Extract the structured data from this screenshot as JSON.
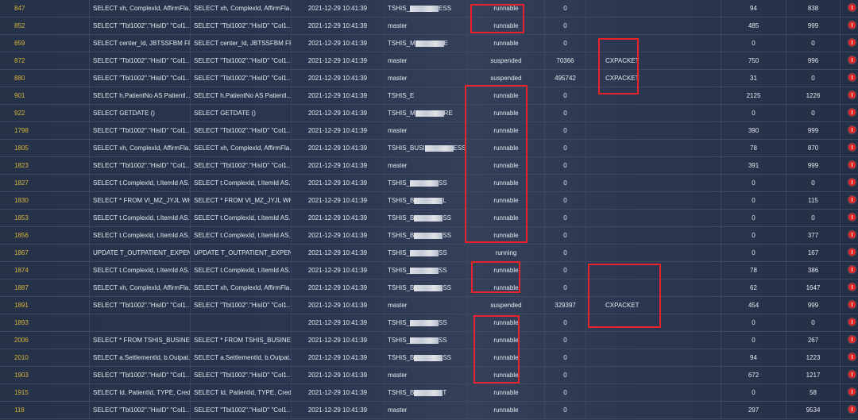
{
  "rows": [
    {
      "id": "847",
      "sql1": "SELECT xh, ComplexId, AffirmFla...",
      "sql2": "SELECT xh, ComplexId, AffirmFla...",
      "time": "2021-12-29 10:41:39",
      "db_prefix": "TSHIS_",
      "db_suffix": "ESS",
      "status": "runnable",
      "wait": "0",
      "wait_type": "",
      "cpu": "94",
      "reads": "838"
    },
    {
      "id": "852",
      "sql1": "SELECT \"Tbl1002\".\"HisID\" \"Col1...",
      "sql2": "SELECT \"Tbl1002\".\"HisID\" \"Col1...",
      "time": "2021-12-29 10:41:39",
      "db_prefix": "master",
      "db_suffix": "",
      "status": "runnable",
      "wait": "0",
      "wait_type": "",
      "cpu": "485",
      "reads": "999"
    },
    {
      "id": "859",
      "sql1": "SELECT center_Id, JBTSSFBM FR...",
      "sql2": "SELECT center_Id, JBTSSFBM FR...",
      "time": "2021-12-29 10:41:39",
      "db_prefix": "TSHIS_M",
      "db_suffix": "E",
      "status": "runnable",
      "wait": "0",
      "wait_type": "",
      "cpu": "0",
      "reads": "0"
    },
    {
      "id": "872",
      "sql1": "SELECT \"Tbl1002\".\"HisID\" \"Col1...",
      "sql2": "SELECT \"Tbl1002\".\"HisID\" \"Col1...",
      "time": "2021-12-29 10:41:39",
      "db_prefix": "master",
      "db_suffix": "",
      "status": "suspended",
      "wait": "70366",
      "wait_type": "CXPACKET",
      "cpu": "750",
      "reads": "996"
    },
    {
      "id": "880",
      "sql1": "SELECT \"Tbl1002\".\"HisID\" \"Col1...",
      "sql2": "SELECT \"Tbl1002\".\"HisID\" \"Col1...",
      "time": "2021-12-29 10:41:39",
      "db_prefix": "master",
      "db_suffix": "",
      "status": "suspended",
      "wait": "495742",
      "wait_type": "CXPACKET",
      "cpu": "31",
      "reads": "0"
    },
    {
      "id": "901",
      "sql1": "SELECT h.PatientNo AS Patientl...",
      "sql2": "SELECT h.PatientNo AS Patientl...",
      "time": "2021-12-29 10:41:39",
      "db_prefix": "TSHIS_E",
      "db_suffix": "",
      "status": "runnable",
      "wait": "0",
      "wait_type": "",
      "cpu": "2125",
      "reads": "1226"
    },
    {
      "id": "922",
      "sql1": "SELECT GETDATE ()",
      "sql2": "SELECT GETDATE ()",
      "time": "2021-12-29 10:41:39",
      "db_prefix": "TSHIS_M",
      "db_suffix": "RE",
      "status": "runnable",
      "wait": "0",
      "wait_type": "",
      "cpu": "0",
      "reads": "0"
    },
    {
      "id": "1798",
      "sql1": "SELECT \"Tbl1002\".\"HisID\" \"Col1...",
      "sql2": "SELECT \"Tbl1002\".\"HisID\" \"Col1...",
      "time": "2021-12-29 10:41:39",
      "db_prefix": "master",
      "db_suffix": "",
      "status": "runnable",
      "wait": "0",
      "wait_type": "",
      "cpu": "390",
      "reads": "999"
    },
    {
      "id": "1805",
      "sql1": "SELECT xh, ComplexId, AffirmFla...",
      "sql2": "SELECT xh, ComplexId, AffirmFla...",
      "time": "2021-12-29 10:41:39",
      "db_prefix": "TSHIS_BUSI",
      "db_suffix": "ESS",
      "status": "runnable",
      "wait": "0",
      "wait_type": "",
      "cpu": "78",
      "reads": "870"
    },
    {
      "id": "1823",
      "sql1": "SELECT \"Tbl1002\".\"HisID\" \"Col1...",
      "sql2": "SELECT \"Tbl1002\".\"HisID\" \"Col1...",
      "time": "2021-12-29 10:41:39",
      "db_prefix": "master",
      "db_suffix": "",
      "status": "runnable",
      "wait": "0",
      "wait_type": "",
      "cpu": "391",
      "reads": "999"
    },
    {
      "id": "1827",
      "sql1": "SELECT t.ComplexId, t.ItemId AS...",
      "sql2": "SELECT t.ComplexId, t.ItemId AS...",
      "time": "2021-12-29 10:41:39",
      "db_prefix": "TSHIS_",
      "db_suffix": "SS",
      "status": "runnable",
      "wait": "0",
      "wait_type": "",
      "cpu": "0",
      "reads": "0"
    },
    {
      "id": "1830",
      "sql1": "SELECT * FROM VI_MZ_JYJL WH...",
      "sql2": "SELECT * FROM VI_MZ_JYJL WH...",
      "time": "2021-12-29 10:41:39",
      "db_prefix": "TSHIS_B",
      "db_suffix": "L",
      "status": "runnable",
      "wait": "0",
      "wait_type": "",
      "cpu": "0",
      "reads": "115"
    },
    {
      "id": "1853",
      "sql1": "SELECT t.ComplexId, t.ItemId AS...",
      "sql2": "SELECT t.ComplexId, t.ItemId AS...",
      "time": "2021-12-29 10:41:39",
      "db_prefix": "TSHIS_B",
      "db_suffix": "SS",
      "status": "runnable",
      "wait": "0",
      "wait_type": "",
      "cpu": "0",
      "reads": "0"
    },
    {
      "id": "1856",
      "sql1": "SELECT t.ComplexId, t.ItemId AS...",
      "sql2": "SELECT t.ComplexId, t.ItemId AS...",
      "time": "2021-12-29 10:41:39",
      "db_prefix": "TSHIS_B",
      "db_suffix": "SS",
      "status": "runnable",
      "wait": "0",
      "wait_type": "",
      "cpu": "0",
      "reads": "377"
    },
    {
      "id": "1867",
      "sql1": "UPDATE T_OUTPATIENT_EXPEN...",
      "sql2": "UPDATE T_OUTPATIENT_EXPEN...",
      "time": "2021-12-29 10:41:39",
      "db_prefix": "TSHIS_",
      "db_suffix": "SS",
      "status": "running",
      "wait": "0",
      "wait_type": "",
      "cpu": "0",
      "reads": "167"
    },
    {
      "id": "1874",
      "sql1": "SELECT t.ComplexId, t.ItemId AS...",
      "sql2": "SELECT t.ComplexId, t.ItemId AS...",
      "time": "2021-12-29 10:41:39",
      "db_prefix": "TSHIS_",
      "db_suffix": "SS",
      "status": "runnable",
      "wait": "0",
      "wait_type": "",
      "cpu": "78",
      "reads": "386"
    },
    {
      "id": "1887",
      "sql1": "SELECT xh, ComplexId, AffirmFla...",
      "sql2": "SELECT xh, ComplexId, AffirmFla...",
      "time": "2021-12-29 10:41:39",
      "db_prefix": "TSHIS_B",
      "db_suffix": "SS",
      "status": "runnable",
      "wait": "0",
      "wait_type": "",
      "cpu": "62",
      "reads": "1647"
    },
    {
      "id": "1891",
      "sql1": "SELECT \"Tbl1002\".\"HisID\" \"Col1...",
      "sql2": "SELECT \"Tbl1002\".\"HisID\" \"Col1...",
      "time": "2021-12-29 10:41:39",
      "db_prefix": "master",
      "db_suffix": "",
      "status": "suspended",
      "wait": "329397",
      "wait_type": "CXPACKET",
      "cpu": "454",
      "reads": "999"
    },
    {
      "id": "1893",
      "sql1": "",
      "sql2": "",
      "time": "2021-12-29 10:41:39",
      "db_prefix": "TSHIS_",
      "db_suffix": "SS",
      "status": "runnable",
      "wait": "0",
      "wait_type": "",
      "cpu": "0",
      "reads": "0"
    },
    {
      "id": "2006",
      "sql1": "SELECT * FROM TSHIS_BUSINES...",
      "sql2": "SELECT * FROM TSHIS_BUSINES...",
      "time": "2021-12-29 10:41:39",
      "db_prefix": "TSHIS_",
      "db_suffix": "SS",
      "status": "runnable",
      "wait": "0",
      "wait_type": "",
      "cpu": "0",
      "reads": "267"
    },
    {
      "id": "2010",
      "sql1": "SELECT a.SettlementId, b.Outpat...",
      "sql2": "SELECT a.SettlementId, b.Outpat...",
      "time": "2021-12-29 10:41:39",
      "db_prefix": "TSHIS_B",
      "db_suffix": "SS",
      "status": "runnable",
      "wait": "0",
      "wait_type": "",
      "cpu": "94",
      "reads": "1223"
    },
    {
      "id": "1903",
      "sql1": "SELECT \"Tbl1002\".\"HisID\" \"Col1...",
      "sql2": "SELECT \"Tbl1002\".\"HisID\" \"Col1...",
      "time": "2021-12-29 10:41:39",
      "db_prefix": "master",
      "db_suffix": "",
      "status": "runnable",
      "wait": "0",
      "wait_type": "",
      "cpu": "672",
      "reads": "1217"
    },
    {
      "id": "1915",
      "sql1": "SELECT Id, PatientId, TYPE, Cred...",
      "sql2": "SELECT Id, PatientId, TYPE, Cred...",
      "time": "2021-12-29 10:41:39",
      "db_prefix": "TSHIS_B",
      "db_suffix": "T",
      "status": "runnable",
      "wait": "0",
      "wait_type": "",
      "cpu": "0",
      "reads": "58"
    },
    {
      "id": "118",
      "sql1": "SELECT \"Tbl1002\".\"HisID\" \"Col1...",
      "sql2": "SELECT \"Tbl1002\".\"HisID\" \"Col1...",
      "time": "2021-12-29 10:41:39",
      "db_prefix": "master",
      "db_suffix": "",
      "status": "runnable",
      "wait": "0",
      "wait_type": "",
      "cpu": "297",
      "reads": "9534"
    }
  ],
  "row_icon": "error-icon",
  "colors": {
    "highlight": "#e8242a",
    "session_id": "#d8b53a",
    "error": "#e02424"
  }
}
